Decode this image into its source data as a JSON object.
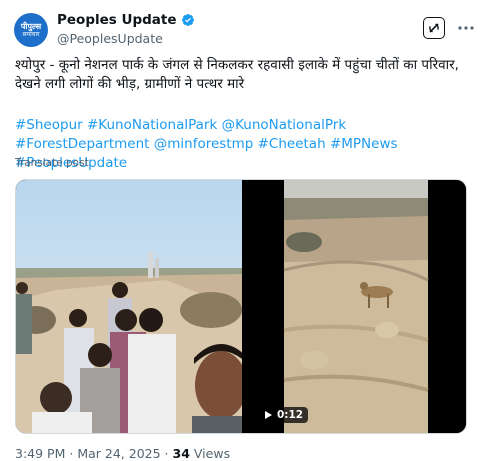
{
  "account": {
    "avatar_line1": "पीपुल्स",
    "avatar_line2": "समाचार",
    "display_name": "Peoples Update",
    "handle": "@PeoplesUpdate"
  },
  "post": {
    "text": "श्योपुर - कूनो नेशनल पार्क के जंगल से निकलकर रहवासी इलाके में पहुंचा चीतों का परिवार, देखने लगी लोगों की भीड़, ग्रामीणों ने पत्थर मारे",
    "hashtags": [
      "#Sheopur",
      "#KunoNationalPark",
      "@KunoNationalPrk",
      "#ForestDepartment",
      "@minforestmp",
      "#Cheetah",
      "#MPNews",
      "#PeoplesUpdate"
    ],
    "translate_label": "Translate post",
    "video_duration": "0:12",
    "time": "3:49 PM",
    "separator": "·",
    "date": "Mar 24, 2025",
    "views_count": "34",
    "views_label": "Views"
  },
  "icons": {
    "verified": "verified-badge-icon",
    "grok": "grok-icon",
    "more": "more-options-icon",
    "play": "play-icon"
  },
  "colors": {
    "link": "#1d9bf0",
    "verified": "#1d9bf0",
    "secondary_text": "#536471"
  }
}
